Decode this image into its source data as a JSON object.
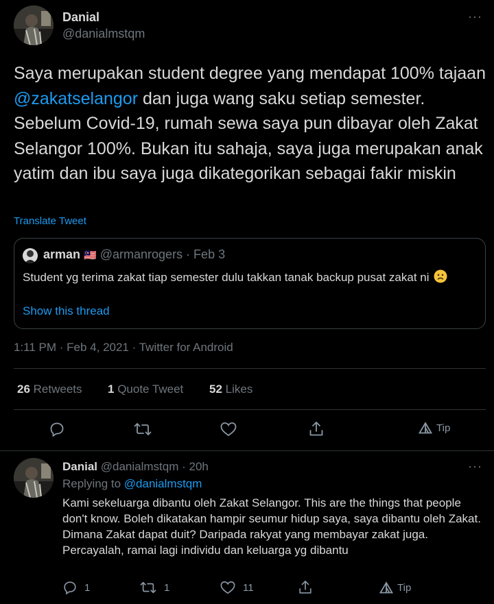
{
  "main_tweet": {
    "author_name": "Danial",
    "author_handle": "@danialmstqm",
    "more": "···",
    "text_before": "Saya merupakan student degree yang mendapat 100% tajaan ",
    "mention": "@zakatselangor",
    "text_after": " dan juga wang saku setiap semester. Sebelum Covid-19, rumah sewa saya pun dibayar oleh Zakat Selangor 100%. Bukan itu sahaja, saya juga merupakan anak yatim dan ibu saya juga dikategorikan sebagai fakir miskin",
    "translate": "Translate Tweet",
    "timestamp": "1:11 PM · Feb 4, 2021 · Twitter for Android"
  },
  "quote": {
    "author_name": "arman",
    "flag": "🇲🇾",
    "meta": "@armanrogers · Feb 3",
    "text": "Student yg terima zakat tiap semester dulu takkan tanak backup pusat zakat ni",
    "emoji": "☹️",
    "show_thread": "Show this thread"
  },
  "stats": {
    "retweets_count": "26",
    "retweets_label": "Retweets",
    "quotes_count": "1",
    "quotes_label": "Quote Tweet",
    "likes_count": "52",
    "likes_label": "Likes"
  },
  "actions": {
    "tip_label": "Tip",
    "icons": [
      "reply-icon",
      "retweet-icon",
      "like-icon",
      "share-icon",
      "tip-icon"
    ]
  },
  "reply": {
    "author_name": "Danial",
    "meta": "@danialmstqm · 20h",
    "more": "···",
    "replying_prefix": "Replying to ",
    "replying_to": "@danialmstqm",
    "text": "Kami sekeluarga dibantu oleh Zakat Selangor. This are the things that people don't know. Boleh dikatakan hampir seumur hidup saya, saya dibantu oleh Zakat. Dimana Zakat dapat duit? Daripada rakyat yang membayar zakat juga. Percayalah, ramai lagi individu dan keluarga yg dibantu",
    "reply_count": "1",
    "retweet_count": "1",
    "like_count": "11",
    "tip_label": "Tip"
  },
  "colors": {
    "background": "#000000",
    "link": "#1d9bf0",
    "muted": "#6e767d",
    "text": "#d9d9d9"
  }
}
